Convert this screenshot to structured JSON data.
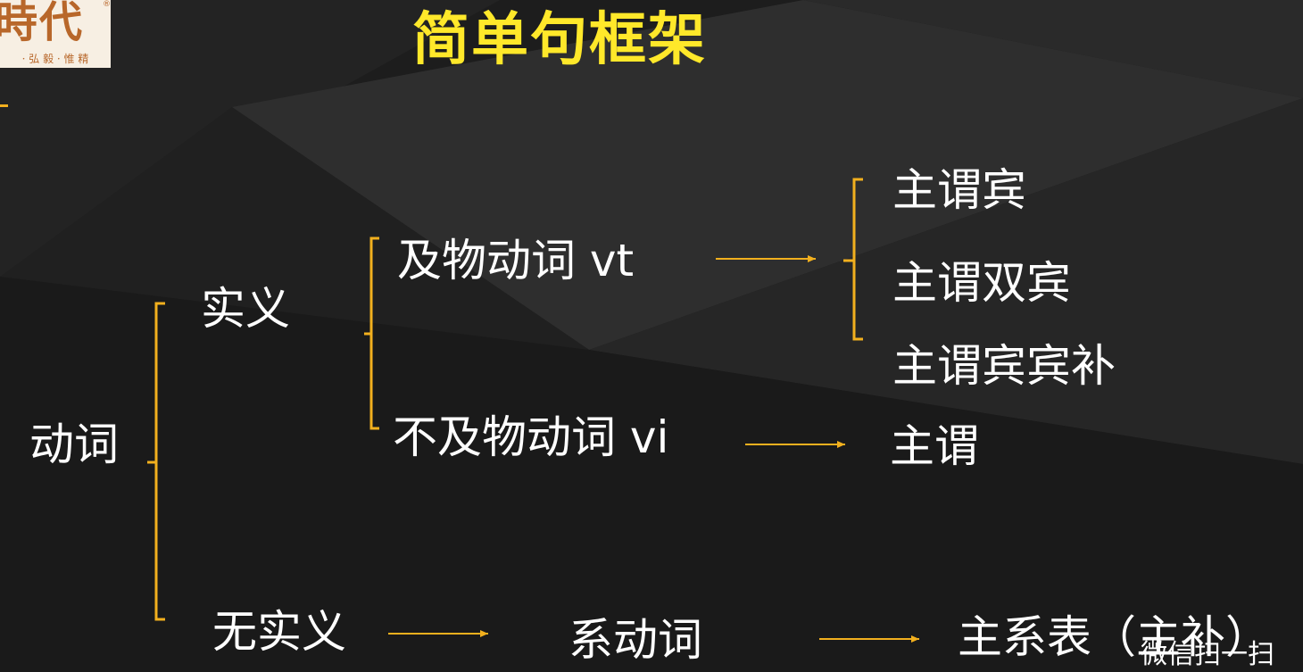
{
  "logo": {
    "main": "時代",
    "sub": "· 弘 毅 · 惟 精",
    "mark": "®"
  },
  "title": "简单句框架",
  "tree": {
    "root": "动词",
    "meaningful": "实义",
    "transitive": "及物动词 vt",
    "intransitive": "不及物动词 vi",
    "vt_patterns": [
      "主谓宾",
      "主谓双宾",
      "主谓宾宾补"
    ],
    "vi_pattern": "主谓",
    "non_meaningful": "无实义",
    "linking_verb": "系动词",
    "linking_pattern": "主系表（主补）"
  },
  "watermark": "微信扫一扫",
  "colors": {
    "title": "#ffe82a",
    "bracket": "#f2b01e",
    "arrow": "#f2b01e",
    "text": "#ffffff",
    "background": "#1b1b1b"
  }
}
